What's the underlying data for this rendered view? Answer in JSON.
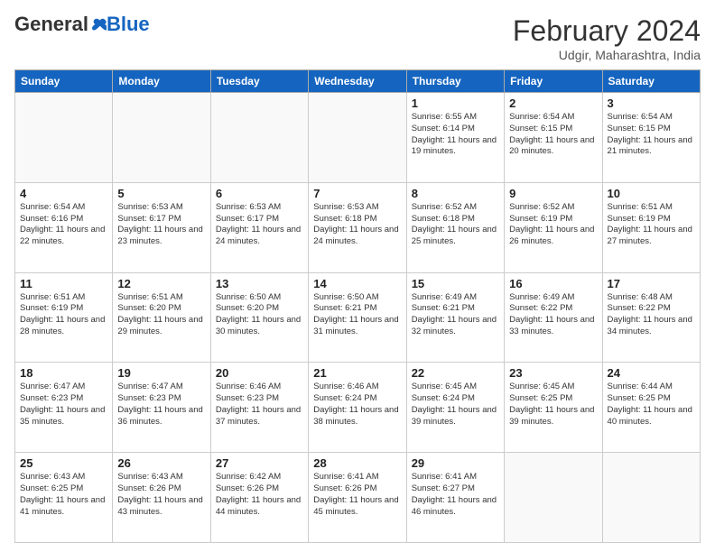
{
  "header": {
    "logo_general": "General",
    "logo_blue": "Blue",
    "title": "February 2024",
    "subtitle": "Udgir, Maharashtra, India"
  },
  "days_of_week": [
    "Sunday",
    "Monday",
    "Tuesday",
    "Wednesday",
    "Thursday",
    "Friday",
    "Saturday"
  ],
  "weeks": [
    [
      {
        "day": "",
        "info": ""
      },
      {
        "day": "",
        "info": ""
      },
      {
        "day": "",
        "info": ""
      },
      {
        "day": "",
        "info": ""
      },
      {
        "day": "1",
        "info": "Sunrise: 6:55 AM\nSunset: 6:14 PM\nDaylight: 11 hours and 19 minutes."
      },
      {
        "day": "2",
        "info": "Sunrise: 6:54 AM\nSunset: 6:15 PM\nDaylight: 11 hours and 20 minutes."
      },
      {
        "day": "3",
        "info": "Sunrise: 6:54 AM\nSunset: 6:15 PM\nDaylight: 11 hours and 21 minutes."
      }
    ],
    [
      {
        "day": "4",
        "info": "Sunrise: 6:54 AM\nSunset: 6:16 PM\nDaylight: 11 hours and 22 minutes."
      },
      {
        "day": "5",
        "info": "Sunrise: 6:53 AM\nSunset: 6:17 PM\nDaylight: 11 hours and 23 minutes."
      },
      {
        "day": "6",
        "info": "Sunrise: 6:53 AM\nSunset: 6:17 PM\nDaylight: 11 hours and 24 minutes."
      },
      {
        "day": "7",
        "info": "Sunrise: 6:53 AM\nSunset: 6:18 PM\nDaylight: 11 hours and 24 minutes."
      },
      {
        "day": "8",
        "info": "Sunrise: 6:52 AM\nSunset: 6:18 PM\nDaylight: 11 hours and 25 minutes."
      },
      {
        "day": "9",
        "info": "Sunrise: 6:52 AM\nSunset: 6:19 PM\nDaylight: 11 hours and 26 minutes."
      },
      {
        "day": "10",
        "info": "Sunrise: 6:51 AM\nSunset: 6:19 PM\nDaylight: 11 hours and 27 minutes."
      }
    ],
    [
      {
        "day": "11",
        "info": "Sunrise: 6:51 AM\nSunset: 6:19 PM\nDaylight: 11 hours and 28 minutes."
      },
      {
        "day": "12",
        "info": "Sunrise: 6:51 AM\nSunset: 6:20 PM\nDaylight: 11 hours and 29 minutes."
      },
      {
        "day": "13",
        "info": "Sunrise: 6:50 AM\nSunset: 6:20 PM\nDaylight: 11 hours and 30 minutes."
      },
      {
        "day": "14",
        "info": "Sunrise: 6:50 AM\nSunset: 6:21 PM\nDaylight: 11 hours and 31 minutes."
      },
      {
        "day": "15",
        "info": "Sunrise: 6:49 AM\nSunset: 6:21 PM\nDaylight: 11 hours and 32 minutes."
      },
      {
        "day": "16",
        "info": "Sunrise: 6:49 AM\nSunset: 6:22 PM\nDaylight: 11 hours and 33 minutes."
      },
      {
        "day": "17",
        "info": "Sunrise: 6:48 AM\nSunset: 6:22 PM\nDaylight: 11 hours and 34 minutes."
      }
    ],
    [
      {
        "day": "18",
        "info": "Sunrise: 6:47 AM\nSunset: 6:23 PM\nDaylight: 11 hours and 35 minutes."
      },
      {
        "day": "19",
        "info": "Sunrise: 6:47 AM\nSunset: 6:23 PM\nDaylight: 11 hours and 36 minutes."
      },
      {
        "day": "20",
        "info": "Sunrise: 6:46 AM\nSunset: 6:23 PM\nDaylight: 11 hours and 37 minutes."
      },
      {
        "day": "21",
        "info": "Sunrise: 6:46 AM\nSunset: 6:24 PM\nDaylight: 11 hours and 38 minutes."
      },
      {
        "day": "22",
        "info": "Sunrise: 6:45 AM\nSunset: 6:24 PM\nDaylight: 11 hours and 39 minutes."
      },
      {
        "day": "23",
        "info": "Sunrise: 6:45 AM\nSunset: 6:25 PM\nDaylight: 11 hours and 39 minutes."
      },
      {
        "day": "24",
        "info": "Sunrise: 6:44 AM\nSunset: 6:25 PM\nDaylight: 11 hours and 40 minutes."
      }
    ],
    [
      {
        "day": "25",
        "info": "Sunrise: 6:43 AM\nSunset: 6:25 PM\nDaylight: 11 hours and 41 minutes."
      },
      {
        "day": "26",
        "info": "Sunrise: 6:43 AM\nSunset: 6:26 PM\nDaylight: 11 hours and 43 minutes."
      },
      {
        "day": "27",
        "info": "Sunrise: 6:42 AM\nSunset: 6:26 PM\nDaylight: 11 hours and 44 minutes."
      },
      {
        "day": "28",
        "info": "Sunrise: 6:41 AM\nSunset: 6:26 PM\nDaylight: 11 hours and 45 minutes."
      },
      {
        "day": "29",
        "info": "Sunrise: 6:41 AM\nSunset: 6:27 PM\nDaylight: 11 hours and 46 minutes."
      },
      {
        "day": "",
        "info": ""
      },
      {
        "day": "",
        "info": ""
      }
    ]
  ]
}
